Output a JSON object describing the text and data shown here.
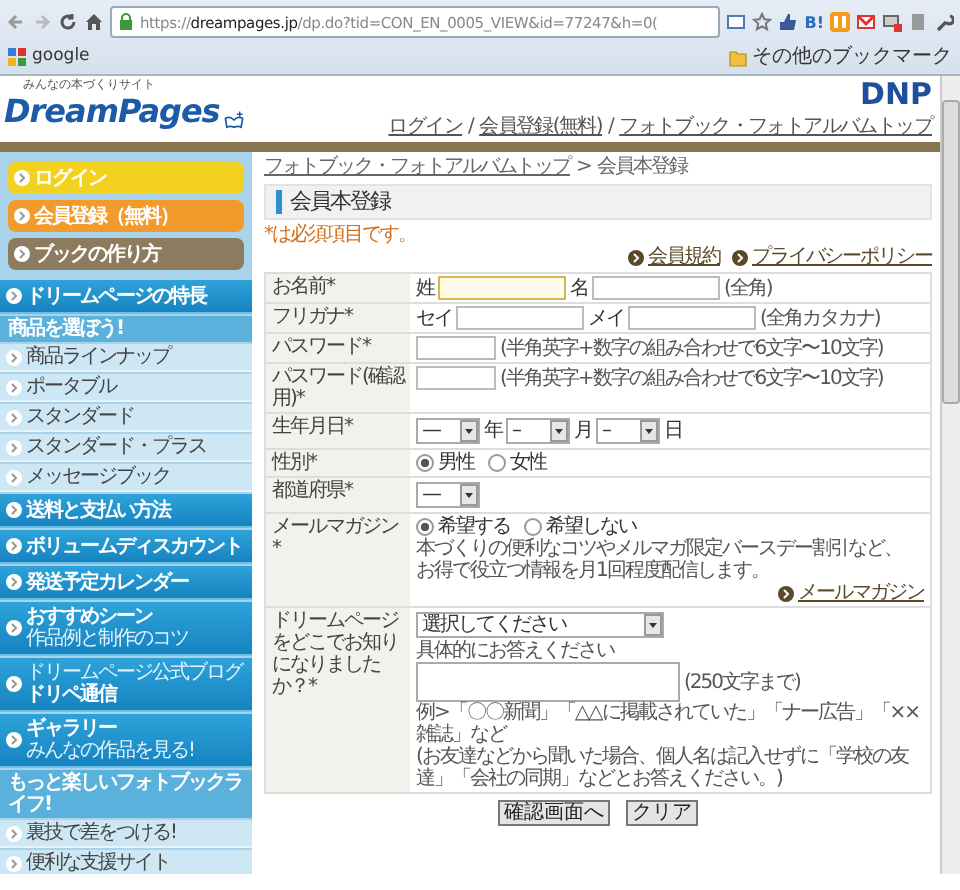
{
  "browser": {
    "url": "https://**dreampages.jp**/dp.do?tid=CON_EN_0005_VIEW&id=77247&h=0(",
    "toolbar_text": "B!",
    "bookmarks": [
      {
        "label": "google"
      }
    ],
    "other_bookmarks": "その他のブックマーク"
  },
  "header": {
    "tagline": "みんなの本づくりサイト",
    "logo": "DreamPages",
    "brand": "DNP",
    "links": [
      "ログイン",
      "会員登録(無料)",
      "フォトブック・フォトアルバムトップ"
    ],
    "separator": "/"
  },
  "sidebar": [
    {
      "kind": "pill",
      "label": "ログイン",
      "color": "#f2d21e"
    },
    {
      "kind": "pill",
      "label": "会員登録（無料）",
      "color": "#f39a2c"
    },
    {
      "kind": "pill",
      "label": "ブックの作り方",
      "color": "#8c7b5e"
    },
    {
      "kind": "nav",
      "label": "ドリームページの特長"
    },
    {
      "kind": "section",
      "label": "商品を選ぼう!"
    },
    {
      "kind": "sub",
      "label": "商品ラインナップ"
    },
    {
      "kind": "sub",
      "label": "ポータブル"
    },
    {
      "kind": "sub",
      "label": "スタンダード"
    },
    {
      "kind": "sub",
      "label": "スタンダード・プラス"
    },
    {
      "kind": "sub",
      "label": "メッセージブック"
    },
    {
      "kind": "nav",
      "label": "送料と支払い方法"
    },
    {
      "kind": "nav",
      "label": "ボリュームディスカウント"
    },
    {
      "kind": "nav",
      "label": "発送予定カレンダー"
    },
    {
      "kind": "nav",
      "label": "おすすめシーン",
      "caption": "作品例と制作のコツ"
    },
    {
      "kind": "nav",
      "label": "ドリペ通信",
      "kicker": "ドリームページ公式ブログ"
    },
    {
      "kind": "nav",
      "label": "ギャラリー",
      "caption": "みんなの作品を見る!"
    },
    {
      "kind": "section",
      "label": "もっと楽しいフォトブックライフ!"
    },
    {
      "kind": "sub",
      "label": "裏技で差をつける!"
    },
    {
      "kind": "sub",
      "label": "便利な支援サイト"
    }
  ],
  "breadcrumb": {
    "link": "フォトブック・フォトアルバムトップ",
    "separator": ">",
    "current": "会員本登録"
  },
  "title": "会員本登録",
  "required_note": "*は必須項目です。",
  "policy_links": [
    "会員規約",
    "プライバシーポリシー"
  ],
  "form_rows": [
    {
      "label": "お名前*",
      "lines": [
        [
          {
            "kind": "text",
            "text": "姓"
          },
          {
            "kind": "input",
            "focused": true
          },
          {
            "kind": "text",
            "text": "名"
          },
          {
            "kind": "input",
            "focused": false
          },
          {
            "kind": "hint",
            "text": "(全角)"
          }
        ]
      ]
    },
    {
      "label": "フリガナ*",
      "lines": [
        [
          {
            "kind": "text",
            "text": "セイ"
          },
          {
            "kind": "input",
            "focused": false
          },
          {
            "kind": "text",
            "text": "メイ"
          },
          {
            "kind": "input",
            "focused": false
          },
          {
            "kind": "hint",
            "text": "(全角カタカナ)"
          }
        ]
      ]
    },
    {
      "label": "パスワード*",
      "lines": [
        [
          {
            "kind": "input",
            "focused": false
          },
          {
            "kind": "hint",
            "text": "(半角英字+数字の組み合わせで6文字〜10文字)"
          }
        ]
      ]
    },
    {
      "label": "パスワード(確認用)*",
      "lines": [
        [
          {
            "kind": "input",
            "focused": false
          },
          {
            "kind": "hint",
            "text": "(半角英字+数字の組み合わせで6文字〜10文字)"
          }
        ]
      ]
    },
    {
      "label": "生年月日*",
      "lines": [
        [
          {
            "kind": "select",
            "value": "—"
          },
          {
            "kind": "text",
            "text": "年"
          },
          {
            "kind": "select",
            "value": "–"
          },
          {
            "kind": "text",
            "text": "月"
          },
          {
            "kind": "select",
            "value": "–"
          },
          {
            "kind": "text",
            "text": "日"
          }
        ]
      ]
    },
    {
      "label": "性別*",
      "lines": [
        [
          {
            "kind": "radio",
            "text": "男性",
            "selected": true
          },
          {
            "kind": "radio",
            "text": "女性",
            "selected": false
          }
        ]
      ]
    },
    {
      "label": "都道府県*",
      "lines": [
        [
          {
            "kind": "select",
            "value": "—"
          }
        ]
      ]
    },
    {
      "label": "メールマガジン*",
      "lines": [
        [
          {
            "kind": "radio",
            "text": "希望する",
            "selected": true
          },
          {
            "kind": "radio",
            "text": "希望しない",
            "selected": false
          }
        ],
        [
          {
            "kind": "note",
            "text": "本づくりの便利なコツやメルマガ限定バースデー割引など、"
          }
        ],
        [
          {
            "kind": "note",
            "text": "お得で役立つ情報を月1回程度配信します。"
          }
        ],
        [
          {
            "kind": "link",
            "text": "メールマガジン"
          }
        ]
      ]
    },
    {
      "label": "ドリームページをどこでお知りになりましたか？*",
      "lines": [
        [
          {
            "kind": "select",
            "value": "選択してください"
          }
        ],
        [
          {
            "kind": "note",
            "text": "具体的にお答えください"
          }
        ],
        [
          {
            "kind": "textarea"
          },
          {
            "kind": "hint",
            "text": "(250文字まで)"
          }
        ],
        [
          {
            "kind": "note",
            "text": "例>「〇〇新聞」「△△に掲載されていた」「ナー広告」「××雑誌」など"
          }
        ],
        [
          {
            "kind": "note",
            "text": "(お友達などから聞いた場合、個人名は記入せずに「学校の友達」「会社の同期」などとお答えください。)"
          }
        ]
      ]
    }
  ],
  "buttons": [
    "確認画面へ",
    "クリア"
  ]
}
